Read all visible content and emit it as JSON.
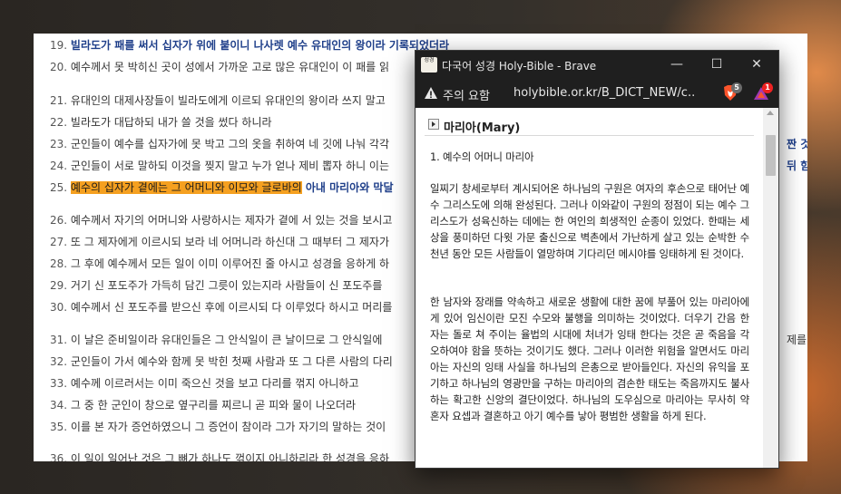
{
  "bible_page": {
    "verses": [
      {
        "num": "19.",
        "text": "빌라도가 패를 써서 십자가 위에 붙이니 나사렛 예수 유대인의 왕이라 기록되었더라"
      },
      {
        "num": "20.",
        "text": "예수께서 못 박히신 곳이 성에서 가까운 고로 많은 유대인이 이 패를 읽"
      },
      {
        "num": "21.",
        "text": "유대인의 대제사장들이 빌라도에게 이르되 유대인의 왕이라 쓰지 말고"
      },
      {
        "num": "22.",
        "text": "빌라도가 대답하되 내가 쓸 것을 썼다 하니라"
      },
      {
        "num": "23.",
        "text": "군인들이 예수를 십자가에 못 박고 그의 옷을 취하여 네 깃에 나눠 각각"
      },
      {
        "num": "24.",
        "text": "군인들이 서로 말하되 이것을 찢지 말고 누가 얻나 제비 뽑자 하니 이는"
      },
      {
        "num": "25.",
        "text_highlight": "예수의 십자가 곁에는 그 어머니와 이모와 글로바의",
        "text": " 아내 마리아와 막달"
      },
      {
        "num": "26.",
        "text": "예수께서 자기의 어머니와 사랑하시는 제자가 곁에 서 있는 것을 보시고"
      },
      {
        "num": "27.",
        "text": "또 그 제자에게 이르시되 보라 네 어머니라 하신대 그 때부터 그 제자가"
      },
      {
        "num": "28.",
        "text": "그 후에 예수께서 모든 일이 이미 이루어진 줄 아시고 성경을 응하게 하"
      },
      {
        "num": "29.",
        "text": "거기 신 포도주가 가득히 담긴 그릇이 있는지라 사람들이 신 포도주를"
      },
      {
        "num": "30.",
        "text": "예수께서 신 포도주를 받으신 후에 이르시되 다 이루었다 하시고 머리를"
      },
      {
        "num": "31.",
        "text": "이 날은 준비일이라 유대인들은 그 안식일이 큰 날이므로 그 안식일에"
      },
      {
        "num": "32.",
        "text": "군인들이 가서 예수와 함께 못 박힌 첫째 사람과 또 그 다른 사람의 다리"
      },
      {
        "num": "33.",
        "text": "예수께 이르러서는 이미 죽으신 것을 보고 다리를 꺾지 아니하고"
      },
      {
        "num": "34.",
        "text": "그 중 한 군인이 창으로 옆구리를 찌르니 곧 피와 물이 나오더라"
      },
      {
        "num": "35.",
        "text": "이를 본 자가 증언하였으니 그 증언이 참이라 그가 자기의 말하는 것이"
      },
      {
        "num": "36.",
        "text": "이 일이 일어난 것은 그 뼈가 하나도 꺾이지 아니하리라 한 성경을 응하"
      }
    ],
    "right_fragments": [
      "짠 것이",
      "뒤 함이",
      "제를 차"
    ]
  },
  "window": {
    "app_icon_text": "성경",
    "title": "다국어 성경 Holy-Bible - Brave",
    "minimize": "—",
    "maximize": "☐",
    "close": "✕",
    "warning_text": "주의 요함",
    "url": "holybible.or.kr/B_DICT_NEW/c...",
    "shield_badge": "5",
    "rewards_badge": "1",
    "accent": "#fb542b"
  },
  "entry": {
    "title": "마리아(Mary)",
    "section": "1. 예수의 어머니 마리아",
    "paragraph1": "일찌기 창세로부터 계시되어온 하나님의 구원은 여자의 후손으로 태어난 예수 그리스도에 의해 완성된다. 그러나 이와같이 구원의 정점이 되는 예수 그리스도가 성육신하는 데에는 한 여인의 희생적인 순종이 있었다. 한때는 세상을 풍미하던 다윗 가문 출신으로 벽촌에서 가난하게 살고 있는 순박한 수천년 동안 모든 사람들이 열망하며 기다리던 메시야를 잉태하게 된 것이다.",
    "paragraph2": "한 남자와 장래를 약속하고 새로운 생활에 대한 꿈에 부풀어 있는 마리아에게 있어 임신이란 모진 수모와 불행을 의미하는 것이었다. 더우기 간음 한 자는 돌로 쳐 주이는 율법의 시대에 처녀가 잉태 한다는 것은 곧 죽음을 각오하여야 함을 뜻하는 것이기도 했다. 그러나 이러한 위험을 알면서도 마리아는 자신의 잉태 사실을 하나님의 은총으로 받아들인다. 자신의 유익을 포기하고 하나님의 영광만을 구하는 마리아의 겸손한 태도는 죽음까지도 불사하는 확고한 신앙의 결단이었다. 하나님의 도우심으로 마리아는 무사히 약혼자 요셉과 결혼하고 아기 예수를 낳아 평범한 생활을 하게 된다."
  }
}
